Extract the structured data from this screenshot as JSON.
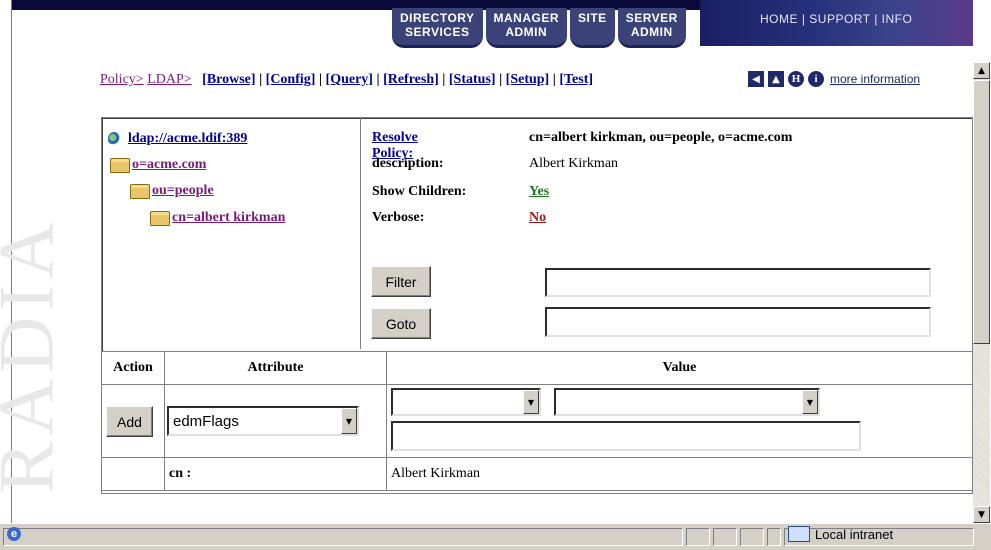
{
  "top_nav": {
    "tabs": [
      {
        "line1": "DIRECTORY",
        "line2": "SERVICES"
      },
      {
        "line1": "MANAGER",
        "line2": "ADMIN"
      },
      {
        "line1": "SITE",
        "line2": ""
      },
      {
        "line1": "SERVER",
        "line2": "ADMIN"
      }
    ],
    "links": {
      "home": "HOME",
      "sep1": " | ",
      "support": "SUPPORT",
      "sep2": " | ",
      "info": "INFO"
    }
  },
  "watermark": "RADIA",
  "breadcrumb": {
    "policy": "Policy>",
    "ldap": "LDAP>",
    "commands": [
      "[Browse]",
      "[Config]",
      "[Query]",
      "[Refresh]",
      "[Status]",
      "[Setup]",
      "[Test]"
    ],
    "separator": "|",
    "more_information": "more information"
  },
  "nav_icons": {
    "back": "◀",
    "up": "▲",
    "help": "H",
    "info": "i"
  },
  "tree": {
    "root": "ldap://acme.ldif:389",
    "items": [
      {
        "label": "o=acme.com"
      },
      {
        "label": "ou=people"
      },
      {
        "label": "cn=albert kirkman"
      }
    ]
  },
  "details": {
    "resolve_label": "Resolve Policy:",
    "resolve_value": "cn=albert kirkman, ou=people, o=acme.com",
    "description_label": "description:",
    "description_value": "Albert Kirkman",
    "show_children_label": "Show Children:",
    "show_children_value": "Yes",
    "verbose_label": "Verbose:",
    "verbose_value": "No",
    "filter_button": "Filter",
    "goto_button": "Goto",
    "filter_value": "",
    "goto_value": ""
  },
  "table": {
    "headers": {
      "action": "Action",
      "attribute": "Attribute",
      "value": "Value"
    },
    "add_button": "Add",
    "attribute_selected": "edmFlags",
    "rows": [
      {
        "attribute": "cn :",
        "value": "Albert Kirkman"
      }
    ]
  },
  "statusbar": {
    "zone": "Local intranet"
  },
  "colors": {
    "nav_dark": "#1f2a6a",
    "link_visited": "#7a1a7a",
    "link": "#000099",
    "yes": "#1a7a1a",
    "no": "#9a1a1a"
  }
}
